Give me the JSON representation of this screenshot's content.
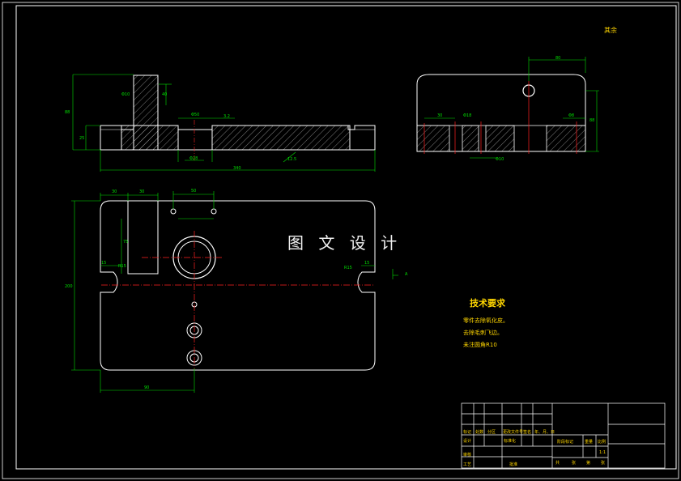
{
  "watermark": "图 文 设 计",
  "roughness_note": "其余",
  "tech_requirements": {
    "title": "技术要求",
    "lines": [
      "零件去除氧化皮。",
      "去除毛刺飞边。",
      "未注圆角R10"
    ]
  },
  "title_block": {
    "labels": [
      "标记",
      "处数",
      "分区",
      "更改文件号",
      "签名",
      "年、月、日",
      "设计",
      "标准化",
      "阶段标记",
      "重量",
      "比例",
      "审核",
      "工艺",
      "批准",
      "共",
      "张",
      "第",
      "张"
    ],
    "scale": "1:1"
  },
  "colors": {
    "outline": "#ffffff",
    "dimension": "#00e000",
    "centerline": "#ff2020",
    "hatch": "#ffffff",
    "text": "#ffd600",
    "background": "#000000"
  }
}
